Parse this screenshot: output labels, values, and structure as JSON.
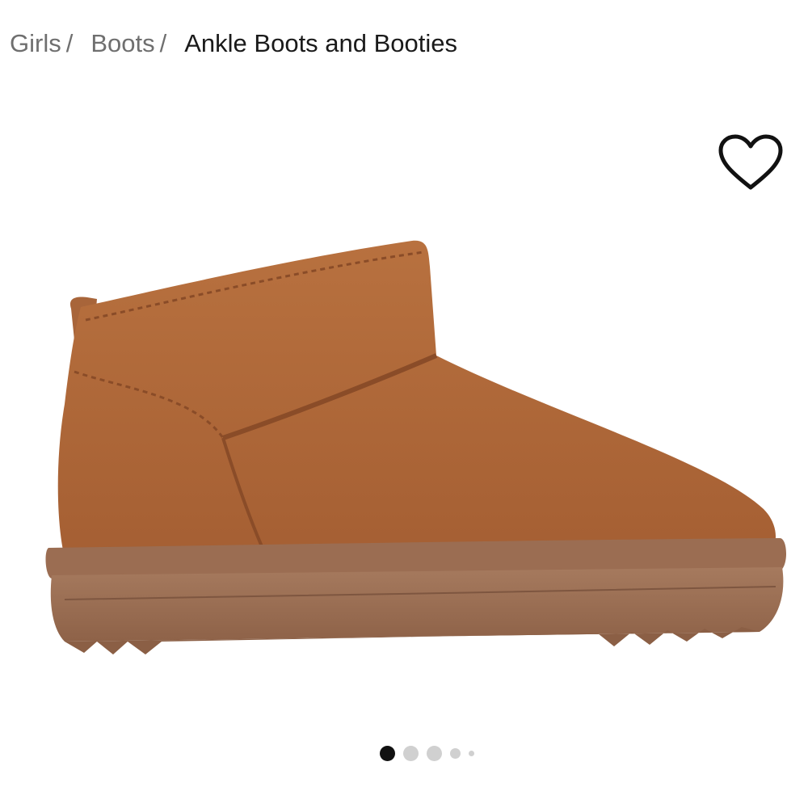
{
  "breadcrumb": {
    "items": [
      {
        "label": "Girls",
        "separator": "/"
      },
      {
        "label": "Boots",
        "separator": "/"
      }
    ],
    "current": "Ankle Boots and Booties"
  },
  "favorite": {
    "icon": "heart-outline-icon"
  },
  "product_image": {
    "icon": "ankle-boot-image",
    "color": "#b06a3e",
    "sole_color": "#9a6f55"
  },
  "carousel": {
    "count": 5,
    "active_index": 0
  }
}
